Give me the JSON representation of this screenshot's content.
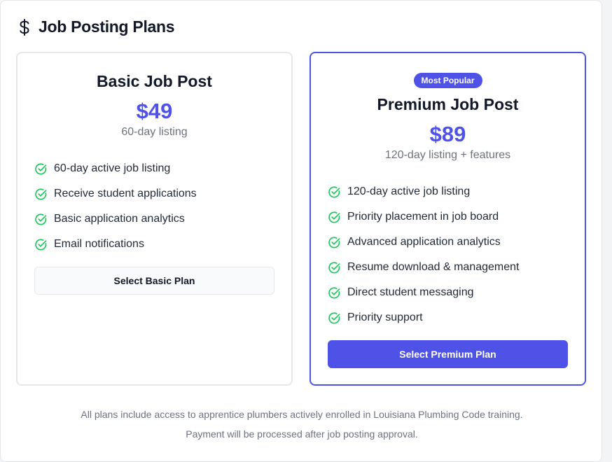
{
  "header": {
    "icon": "dollar-icon",
    "title": "Job Posting Plans"
  },
  "plans": [
    {
      "name": "Basic Job Post",
      "price": "$49",
      "duration": "60-day listing",
      "features": [
        "60-day active job listing",
        "Receive student applications",
        "Basic application analytics",
        "Email notifications"
      ],
      "button_label": "Select Basic Plan"
    },
    {
      "badge": "Most Popular",
      "name": "Premium Job Post",
      "price": "$89",
      "duration": "120-day listing + features",
      "features": [
        "120-day active job listing",
        "Priority placement in job board",
        "Advanced application analytics",
        "Resume download & management",
        "Direct student messaging",
        "Priority support"
      ],
      "button_label": "Select Premium Plan"
    }
  ],
  "footer": {
    "line1": "All plans include access to apprentice plumbers actively enrolled in Louisiana Plumbing Code training.",
    "line2": "Payment will be processed after job posting approval."
  },
  "colors": {
    "accent": "#4f52e6",
    "check": "#22c55e",
    "muted_text": "#6b7280"
  }
}
